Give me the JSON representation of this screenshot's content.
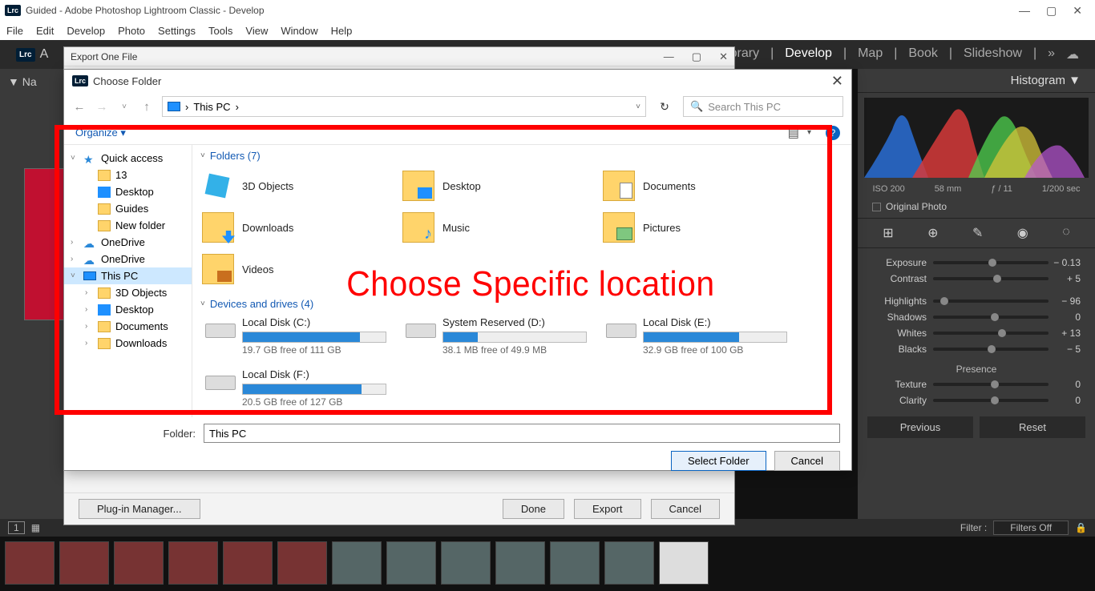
{
  "window": {
    "title": "Guided - Adobe Photoshop Lightroom Classic - Develop",
    "badge": "Lrc"
  },
  "menu": [
    "File",
    "Edit",
    "Develop",
    "Photo",
    "Settings",
    "Tools",
    "View",
    "Window",
    "Help"
  ],
  "modules": {
    "items": [
      "Library",
      "Develop",
      "Map",
      "Book",
      "Slideshow"
    ],
    "active": "Develop",
    "more": "»",
    "cloud_icon": "cloud"
  },
  "left": {
    "nav_label": "Na"
  },
  "right": {
    "histogram_title": "Histogram ▼",
    "meta": {
      "iso": "ISO 200",
      "focal": "58 mm",
      "aperture": "ƒ / 11",
      "shutter": "1/200 sec"
    },
    "original_label": "Original Photo",
    "basic": {
      "exposure": {
        "label": "Exposure",
        "value": "− 0.13",
        "pos": 48
      },
      "contrast": {
        "label": "Contrast",
        "value": "+ 5",
        "pos": 52
      },
      "highlights": {
        "label": "Highlights",
        "value": "− 96",
        "pos": 6
      },
      "shadows": {
        "label": "Shadows",
        "value": "0",
        "pos": 50
      },
      "whites": {
        "label": "Whites",
        "value": "+ 13",
        "pos": 56
      },
      "blacks": {
        "label": "Blacks",
        "value": "− 5",
        "pos": 47
      }
    },
    "presence_label": "Presence",
    "presence": {
      "texture": {
        "label": "Texture",
        "value": "0",
        "pos": 50
      },
      "clarity": {
        "label": "Clarity",
        "value": "0",
        "pos": 50
      }
    },
    "previous": "Previous",
    "reset": "Reset"
  },
  "filter": {
    "label": "Filter :",
    "value": "Filters Off"
  },
  "film_index": "1",
  "export_dialog": {
    "title": "Export One File",
    "plugin": "Plug-in Manager...",
    "done": "Done",
    "export_btn": "Export",
    "cancel": "Cancel"
  },
  "folder_dialog": {
    "title": "Choose Folder",
    "breadcrumb": {
      "root_icon": "pc",
      "path": "This PC",
      "sep": "›"
    },
    "search_placeholder": "Search This PC",
    "organize": "Organize ▾",
    "tree": [
      {
        "chev": "˅",
        "icon": "star",
        "label": "Quick access"
      },
      {
        "chev": "",
        "icon": "folder",
        "label": "13",
        "indent": 1
      },
      {
        "chev": "",
        "icon": "desk",
        "label": "Desktop",
        "indent": 1
      },
      {
        "chev": "",
        "icon": "folder",
        "label": "Guides",
        "indent": 1
      },
      {
        "chev": "",
        "icon": "folder",
        "label": "New folder",
        "indent": 1
      },
      {
        "chev": "›",
        "icon": "cloud",
        "label": "OneDrive"
      },
      {
        "chev": "›",
        "icon": "cloud",
        "label": "OneDrive"
      },
      {
        "chev": "˅",
        "icon": "pc",
        "label": "This PC",
        "selected": true
      },
      {
        "chev": "›",
        "icon": "threeD",
        "label": "3D Objects",
        "indent": 1
      },
      {
        "chev": "›",
        "icon": "desk",
        "label": "Desktop",
        "indent": 1
      },
      {
        "chev": "›",
        "icon": "documents",
        "label": "Documents",
        "indent": 1
      },
      {
        "chev": "›",
        "icon": "downloads",
        "label": "Downloads",
        "indent": 1
      }
    ],
    "folders_header": "Folders (7)",
    "folders": [
      {
        "name": "3D Objects",
        "kind": "threeD"
      },
      {
        "name": "Desktop",
        "kind": "desktop"
      },
      {
        "name": "Documents",
        "kind": "documents"
      },
      {
        "name": "Downloads",
        "kind": "downloads"
      },
      {
        "name": "Music",
        "kind": "music"
      },
      {
        "name": "Pictures",
        "kind": "pictures"
      },
      {
        "name": "Videos",
        "kind": "videos"
      }
    ],
    "drives_header": "Devices and drives (4)",
    "drives": [
      {
        "name": "Local Disk (C:)",
        "free": "19.7 GB free of 111 GB",
        "fill": 82
      },
      {
        "name": "System Reserved (D:)",
        "free": "38.1 MB free of 49.9 MB",
        "fill": 24
      },
      {
        "name": "Local Disk (E:)",
        "free": "32.9 GB free of 100 GB",
        "fill": 67
      },
      {
        "name": "Local Disk (F:)",
        "free": "20.5 GB free of 127 GB",
        "fill": 83
      }
    ],
    "folder_label": "Folder:",
    "folder_value": "This PC",
    "select_btn": "Select Folder",
    "cancel_btn": "Cancel"
  },
  "annotation": "Choose Specific location"
}
